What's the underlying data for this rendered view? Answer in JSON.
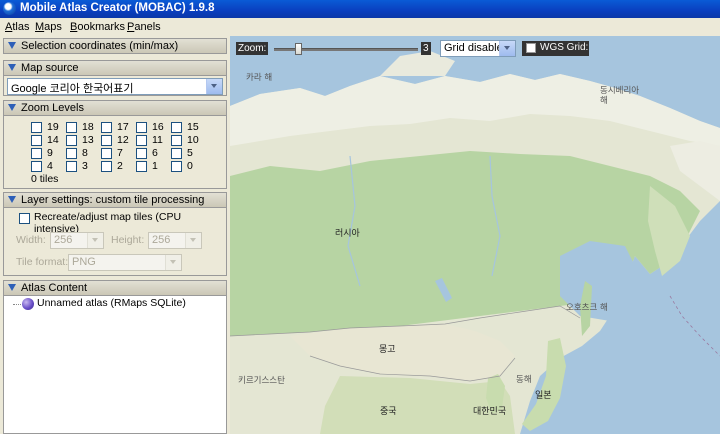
{
  "window": {
    "title": "Mobile Atlas Creator (MOBAC) 1.9.8"
  },
  "menu": [
    {
      "label": "Atlas"
    },
    {
      "label": "Maps"
    },
    {
      "label": "Bookmarks"
    },
    {
      "label": "Panels"
    }
  ],
  "sections": {
    "selection": {
      "title": "Selection coordinates (min/max)"
    },
    "map_source": {
      "title": "Map source",
      "selected": "Google 코리아 한국어표기"
    },
    "zoom_levels": {
      "title": "Zoom Levels",
      "levels": [
        "19",
        "18",
        "17",
        "16",
        "15",
        "14",
        "13",
        "12",
        "11",
        "10",
        "9",
        "8",
        "7",
        "6",
        "5",
        "4",
        "3",
        "2",
        "1",
        "0"
      ],
      "tiles_text": "0 tiles"
    },
    "layer_settings": {
      "title": "Layer settings: custom tile processing",
      "recreate_label": "Recreate/adjust map tiles (CPU intensive)",
      "width_label": "Width:",
      "width_value": "256",
      "height_label": "Height:",
      "height_value": "256",
      "format_label": "Tile format:",
      "format_value": "PNG"
    },
    "atlas_content": {
      "title": "Atlas Content",
      "atlas_name": "Unnamed atlas (RMaps SQLite)"
    }
  },
  "map_toolbar": {
    "zoom_label": "Zoom:",
    "zoom_value": "3",
    "zoom_fraction": 0.15,
    "grid_selected": "Grid disabled",
    "wgs_grid_label": "WGS Grid:"
  },
  "map_labels": {
    "kara_sea": "카라 해",
    "east_siberian_sea": "동시베리아\n해",
    "russia": "러시아",
    "okhotsk": "오호츠크 해",
    "mongolia": "몽고",
    "kyrgyzstan": "키르기스스탄",
    "east_sea": "동해",
    "japan": "일본",
    "korea": "대한민국",
    "china": "중국"
  },
  "colors": {
    "titlebar": "#0A4FCF",
    "map_water": "#A6C5DE",
    "map_forest": "#B7D4A3",
    "map_land": "#E4E6D3",
    "map_snow": "#F3F3EE"
  }
}
